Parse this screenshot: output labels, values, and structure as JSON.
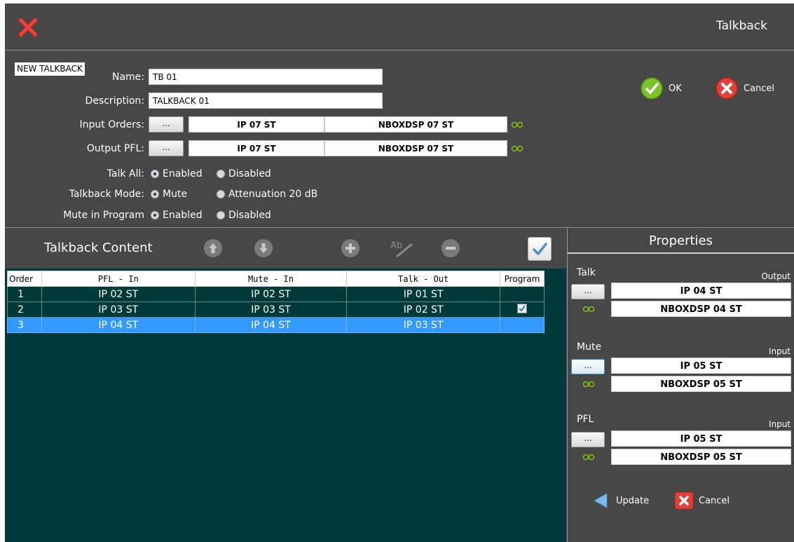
{
  "window": {
    "title": "Talkback"
  },
  "form": {
    "badge": "NEW TALKBACK",
    "name_label": "Name:",
    "name_value": "TB 01",
    "description_label": "Description:",
    "description_value": "TALKBACK 01",
    "input_orders_label": "Input Orders:",
    "input_orders_button": "...",
    "input_orders_source": "IP 07 ST",
    "input_orders_device": "NBOXDSP 07 ST",
    "output_pfl_label": "Output PFL:",
    "output_pfl_button": "...",
    "output_pfl_source": "IP 07 ST",
    "output_pfl_device": "NBOXDSP 07 ST",
    "talk_all_label": "Talk All:",
    "talk_all_opt1": "Enabled",
    "talk_all_opt2": "Disabled",
    "mode_label": "Talkback Mode:",
    "mode_opt1": "Mute",
    "mode_opt2": "Attenuation 20 dB",
    "mute_prog_label": "Mute in Program",
    "mute_prog_opt1": "Enabled",
    "mute_prog_opt2": "Disabled"
  },
  "actions": {
    "ok": "OK",
    "cancel": "Cancel"
  },
  "content": {
    "title": "Talkback Content",
    "columns": [
      "Order",
      "PFL - In",
      "Mute - In",
      "Talk - Out",
      "Program"
    ],
    "rows": [
      {
        "order": "1",
        "pfl": "IP 02 ST",
        "mute": "IP 02 ST",
        "talk": "IP 01 ST",
        "program": false
      },
      {
        "order": "2",
        "pfl": "IP 03 ST",
        "mute": "IP 03 ST",
        "talk": "IP 02 ST",
        "program": true
      },
      {
        "order": "3",
        "pfl": "IP 04 ST",
        "mute": "IP 04 ST",
        "talk": "IP 03 ST",
        "program": false
      }
    ],
    "selected_row": 3
  },
  "properties": {
    "title": "Properties",
    "talk": {
      "label": "Talk",
      "sub": "Output",
      "button": "...",
      "source": "IP 04 ST",
      "device": "NBOXDSP 04 ST"
    },
    "mute": {
      "label": "Mute",
      "sub": "Input",
      "button": "...",
      "source": "IP 05 ST",
      "device": "NBOXDSP 05 ST"
    },
    "pfl": {
      "label": "PFL",
      "sub": "Input",
      "button": "...",
      "source": "IP 05 ST",
      "device": "NBOXDSP 05 ST"
    },
    "update": "Update",
    "cancel": "Cancel"
  },
  "colors": {
    "panel": "#474747",
    "grid_bg": "#003b3a",
    "selection": "#3399ff",
    "link_icon": "#8fd400"
  }
}
